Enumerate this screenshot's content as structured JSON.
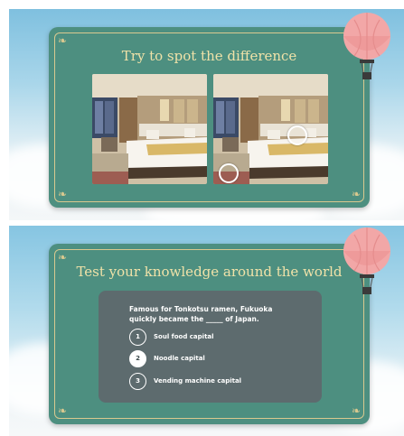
{
  "slide1": {
    "title": "Try to spot the difference"
  },
  "slide2": {
    "title": "Test your knowledge around the world",
    "question": "Famous for Tonkotsu ramen, Fukuoka quickly became the _____ of Japan.",
    "options": [
      {
        "number": "1",
        "label": "Soul food capital",
        "selected": false
      },
      {
        "number": "2",
        "label": "Noodle capital",
        "selected": true
      },
      {
        "number": "3",
        "label": "Vending machine capital",
        "selected": false
      }
    ]
  },
  "colors": {
    "card": "#4d8f80",
    "title": "#f0e2a8",
    "quiz_box": "#5d6b6e",
    "balloon": "#f2a7a7"
  },
  "icons": [
    "hot-air-balloon-icon",
    "flourish-corner-icon"
  ]
}
